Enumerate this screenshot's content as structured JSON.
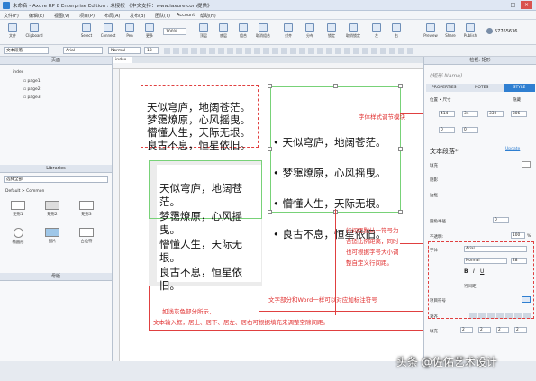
{
  "app": {
    "title": "未命名 - Axure RP 8 Enterprise Edition : 未授权 《中文支持：www.iaxure.com提供》"
  },
  "menus": [
    "文件(F)",
    "编辑(E)",
    "视图(V)",
    "项目(P)",
    "布局(A)",
    "发布(B)",
    "团队(T)",
    "Account",
    "帮助(H)"
  ],
  "toolbar": {
    "items": [
      "文件",
      "Clipboard",
      "Select",
      "Connect",
      "Pen",
      "更多",
      "顶层",
      "底层",
      "组合",
      "取消组合",
      "对齐",
      "分布",
      "锁定",
      "取消锁定",
      "左",
      "右"
    ],
    "zoom": "100%",
    "right_items": [
      "Preview",
      "Share",
      "Publish"
    ],
    "user": "57765636"
  },
  "format": {
    "style": "文本段落",
    "font": "Arial",
    "weight": "Normal",
    "size": "13"
  },
  "pages_panel": {
    "title": "页面",
    "root": "index",
    "pages": [
      "page1",
      "page2",
      "page3"
    ]
  },
  "libraries_panel": {
    "title": "Libraries",
    "select": "选择全部",
    "group": "Default > Common",
    "items": [
      "矩形1",
      "矩形2",
      "矩形3",
      "椭圆形",
      "图片",
      "占位符"
    ]
  },
  "masters_panel": {
    "title": "母版"
  },
  "canvas": {
    "tab": "index",
    "block1": [
      "天似穹庐，地阔苍茫。",
      "梦霭燎原，心风摇曳。",
      "懵懂人生，天际无垠。",
      "良古不息，恒星依旧。"
    ],
    "block2": [
      "天似穹庐，地阔苍",
      "茫。",
      "梦霭燎原，心风摇",
      "曳。",
      "懵懂人生，天际无",
      "垠。",
      "良古不息，恒星依",
      "旧。"
    ],
    "block3": [
      "• 天似穹庐，地阔苍茫。",
      "• 梦霭燎原，心风摇曳。",
      "• 懵懂人生，天际无垠。",
      "• 良古不息，恒星依旧。"
    ]
  },
  "annotations": {
    "font_style": "字体样式调节模块",
    "line_spacing": [
      "行间距默认一符号为",
      "合适比例距离，同时",
      "也可根据字号大小调",
      "整自定义行间距。"
    ],
    "bullet": "文字部分和Word一样可以对应加标注符号",
    "padding": [
      "如浅灰色部分所示，",
      "文本输入框，居上、居下、居左、居右可根据填充来调整空隙间距。"
    ]
  },
  "inspector": {
    "title": "检视: 矩形",
    "name_placeholder": "(矩形 Name)",
    "tabs": [
      "PROPERTIES",
      "NOTES",
      "STYLE"
    ],
    "section_pos": "位置 • 尺寸",
    "hidden": "隐藏",
    "x": "414",
    "y": "34",
    "w": "330",
    "h": "306",
    "zero1": "0",
    "zero2": "0",
    "style_name": "文本段落*",
    "style_link": "Update",
    "fill": "填充",
    "shadow": "阴影",
    "border": "边框",
    "radius": "圆角半径",
    "radius_val": "0",
    "opacity": "不透明:",
    "opacity_val": "100",
    "percent": "%",
    "font_label": "字体",
    "font": "Arial",
    "weight": "Normal",
    "size": "28",
    "line_spacing": "行间距",
    "bullets": "项目符号",
    "align": "对齐",
    "padding": "填充",
    "pad_val": "2"
  },
  "watermark": "头条 @佐佑艺术设计",
  "colors": {
    "annotation": "#e03030",
    "selection": "#78d278",
    "accent": "#2f7fd1"
  }
}
